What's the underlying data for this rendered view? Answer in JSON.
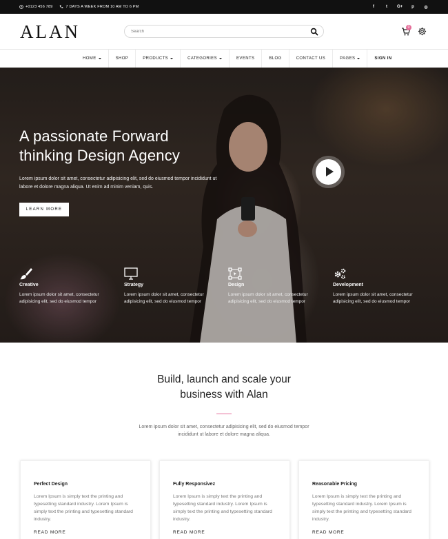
{
  "topbar": {
    "phone": "+0123 456 789",
    "hours": "7 DAYS A WEEK FROM 10 AM TO 6 PM",
    "social": [
      "facebook-icon",
      "twitter-icon",
      "google-plus-icon",
      "pinterest-icon",
      "instagram-icon"
    ],
    "social_glyphs": [
      "f",
      "t",
      "G+",
      "p",
      "◎"
    ]
  },
  "header": {
    "logo": "ALAN",
    "search_placeholder": "Search",
    "cart_count": "0"
  },
  "nav": {
    "items": [
      {
        "label": "HOME",
        "dropdown": true
      },
      {
        "label": "SHOP",
        "dropdown": false
      },
      {
        "label": "PRODUCTS",
        "dropdown": true
      },
      {
        "label": "CATEGORIES",
        "dropdown": true
      },
      {
        "label": "EVENTS",
        "dropdown": false
      },
      {
        "label": "BLOG",
        "dropdown": false
      },
      {
        "label": "CONTACT US",
        "dropdown": false
      },
      {
        "label": "PAGES",
        "dropdown": true
      },
      {
        "label": "SIGN IN",
        "dropdown": false
      }
    ]
  },
  "hero": {
    "title": "A passionate Forward thinking Design Agency",
    "text": "Lorem ipsum dolor sit amet, consectetur adipisicing elit, sed do eiusmod tempor incididunt ut labore et dolore magna aliqua. Ut enim ad minim veniam, quis.",
    "button": "LEARN MORE",
    "features": [
      {
        "icon": "paint-brush-icon",
        "title": "Creative",
        "text": "Lorem ipsum dolor sit amet, consectetur adipisicing elit, sed do eiusmod tempor"
      },
      {
        "icon": "monitor-icon",
        "title": "Strategy",
        "text": "Lorem ipsum dolor sit amet, consectetur adipisicing elit, sed do eiusmod tempor"
      },
      {
        "icon": "vector-design-icon",
        "title": "Design",
        "text": "Lorem ipsum dolor sit amet, consectetur adipisicing elit, sed do eiusmod tempor"
      },
      {
        "icon": "gears-icon",
        "title": "Development",
        "text": "Lorem ipsum dolor sit amet, consectetur adipisicing elit, sed do eiusmod tempor"
      }
    ]
  },
  "section": {
    "title_line1": "Build, launch and scale your",
    "title_line2": "business with Alan",
    "text": "Lorem ipsum dolor sit amet, consectetur adipisicing elit, sed do eiusmod tempor incididunt ut labore et dolore magna aliqua.",
    "accent": "#e56f9a"
  },
  "cards": [
    {
      "title": "Perfect Design",
      "text": "Lorem Ipsum is simply text the printing and typesetting standard industry. Lorem Ipsum is simply text the printing and typesetting standard industry.",
      "more": "READ MORE"
    },
    {
      "title": "Fully Responsivez",
      "text": "Lorem Ipsum is simply text the printing and typesetting standard industry. Lorem Ipsum is simply text the printing and typesetting standard industry.",
      "more": "READ MORE"
    },
    {
      "title": "Reasonable Pricing",
      "text": "Lorem Ipsum is simply text the printing and typesetting standard industry. Lorem Ipsum is simply text the printing and typesetting standard industry.",
      "more": "READ MORE"
    }
  ]
}
